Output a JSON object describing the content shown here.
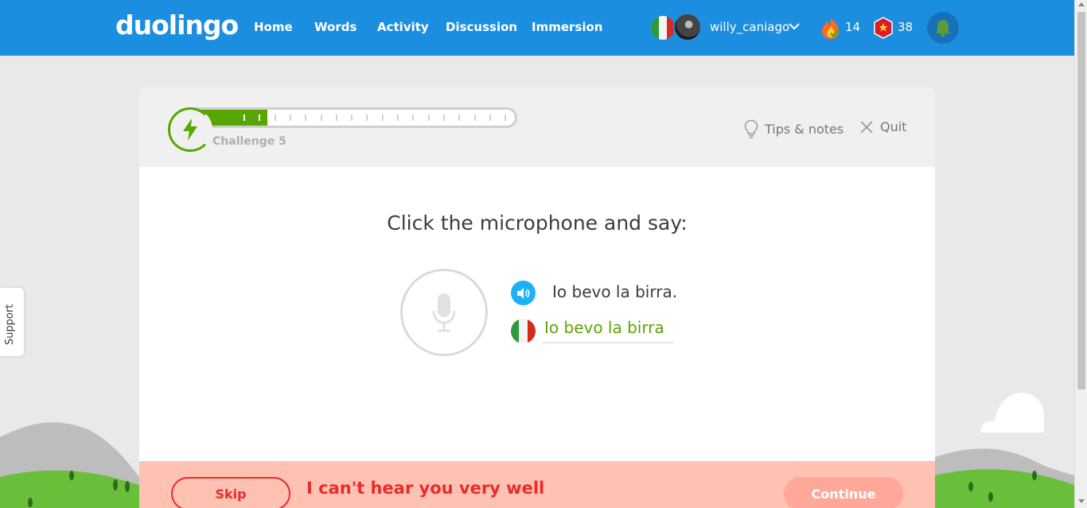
{
  "nav": {
    "logo": "duolingo",
    "items": [
      "Home",
      "Words",
      "Activity",
      "Discussion",
      "Immersion"
    ],
    "username": "willy_caniago",
    "streak": "14",
    "gems": "38"
  },
  "support": "Support",
  "lesson": {
    "progress": 0.24,
    "challenge_label": "Challenge 5",
    "tips_label": "Tips & notes",
    "quit_label": "Quit",
    "prompt": "Click the microphone and say:",
    "phrase": "Io bevo la birra.",
    "answer": "Io bevo la birra"
  },
  "footer": {
    "skip_label": "Skip",
    "feedback": "I can't hear you very well",
    "continue_label": "Continue"
  },
  "colors": {
    "nav": "#1b8ee0",
    "green": "#58a700",
    "footer_bg": "#ffc1b2",
    "error_red": "#ea2b2b"
  }
}
